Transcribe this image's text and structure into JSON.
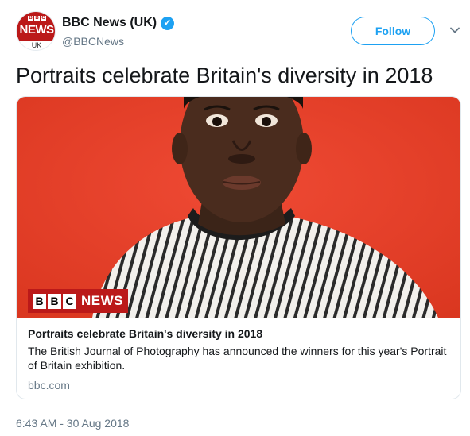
{
  "author": {
    "avatar_logo_text": "BBC",
    "avatar_news_text": "NEWS",
    "avatar_region_text": "UK",
    "display_name": "BBC News (UK)",
    "handle": "@BBCNews",
    "verified_icon": "verified-badge-icon"
  },
  "actions": {
    "follow_label": "Follow",
    "menu_icon": "chevron-down-icon"
  },
  "tweet": {
    "text": "Portraits celebrate Britain's diversity in 2018",
    "timestamp": "6:43 AM - 30 Aug 2018"
  },
  "card": {
    "logo_letters": [
      "B",
      "B",
      "C"
    ],
    "logo_word": "NEWS",
    "title": "Portraits celebrate Britain's diversity in 2018",
    "description": "The British Journal of Photography has announced the winners for this year's Portrait of Britain exhibition.",
    "domain": "bbc.com"
  },
  "colors": {
    "accent": "#1da1f2",
    "bbc_red": "#bb1919",
    "photo_background": "#e8432f",
    "muted_text": "#657786"
  }
}
